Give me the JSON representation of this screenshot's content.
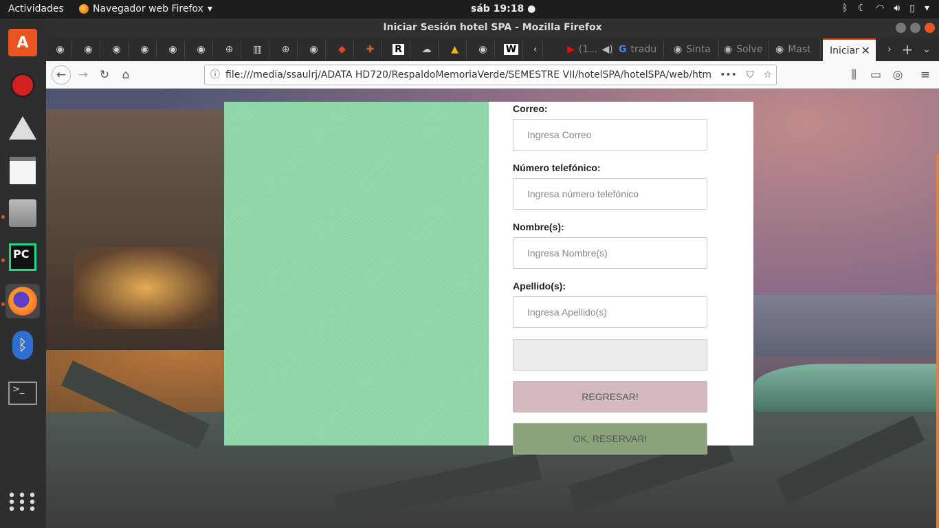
{
  "topbar": {
    "activities": "Actividades",
    "app_name": "Navegador web Firefox",
    "clock": "sáb 19:18"
  },
  "window": {
    "title": "Iniciar Sesión hotel SPA - Mozilla Firefox"
  },
  "tabs": {
    "named": [
      {
        "label": "(1..."
      },
      {
        "label": "tradu"
      },
      {
        "label": "Sinta"
      },
      {
        "label": "Solve"
      },
      {
        "label": "Mast"
      }
    ],
    "active": "Iniciar"
  },
  "navbar": {
    "url": "file:///media/ssaulrj/ADATA HD720/RespaldoMemoriaVerde/SEMESTRE VII/hotelSPA/hotelSPA/web/htm"
  },
  "form": {
    "correo_label": "Correo:",
    "correo_placeholder": "Ingresa Correo",
    "telefono_label": "Número telefónico:",
    "telefono_placeholder": "Ingresa número telefónico",
    "nombre_label": "Nombre(s):",
    "nombre_placeholder": "Ingresa Nombre(s)",
    "apellido_label": "Apellido(s):",
    "apellido_placeholder": "Ingresa Apellido(s)",
    "back_button": "REGRESAR!",
    "ok_button": "OK, RESERVAR!"
  },
  "colors": {
    "green_panel": "#8dd8a8",
    "back_button": "#d4babc",
    "ok_button": "#8aa37b",
    "ubuntu_orange": "#e95420"
  }
}
